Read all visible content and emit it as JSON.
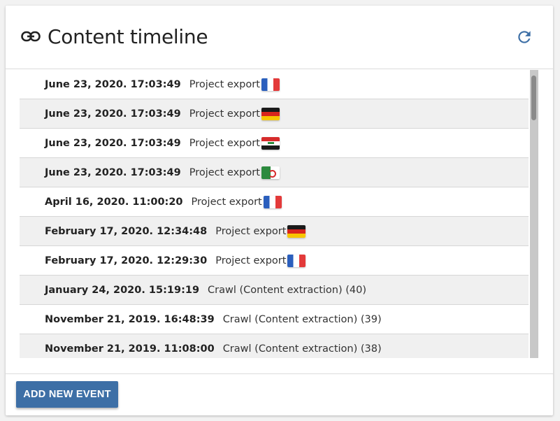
{
  "header": {
    "title": "Content timeline",
    "icon": "link-icon",
    "refresh_icon": "refresh-icon",
    "accent": "#3d6fa6"
  },
  "events": [
    {
      "date": "June 23, 2020. 17:03:49",
      "event": "Project export",
      "flag": "fr"
    },
    {
      "date": "June 23, 2020. 17:03:49",
      "event": "Project export",
      "flag": "de"
    },
    {
      "date": "June 23, 2020. 17:03:49",
      "event": "Project export",
      "flag": "iq"
    },
    {
      "date": "June 23, 2020. 17:03:49",
      "event": "Project export",
      "flag": "dz"
    },
    {
      "date": "April 16, 2020. 11:00:20",
      "event": "Project export",
      "flag": "fr"
    },
    {
      "date": "February 17, 2020. 12:34:48",
      "event": "Project export",
      "flag": "de"
    },
    {
      "date": "February 17, 2020. 12:29:30",
      "event": "Project export",
      "flag": "fr"
    },
    {
      "date": "January 24, 2020. 15:19:19",
      "event": "Crawl (Content extraction) (40)",
      "flag": ""
    },
    {
      "date": "November 21, 2019. 16:48:39",
      "event": "Crawl (Content extraction) (39)",
      "flag": ""
    },
    {
      "date": "November 21, 2019. 11:08:00",
      "event": "Crawl (Content extraction) (38)",
      "flag": ""
    }
  ],
  "footer": {
    "add_button_label": "ADD NEW EVENT",
    "button_color": "#3d6fa6"
  }
}
